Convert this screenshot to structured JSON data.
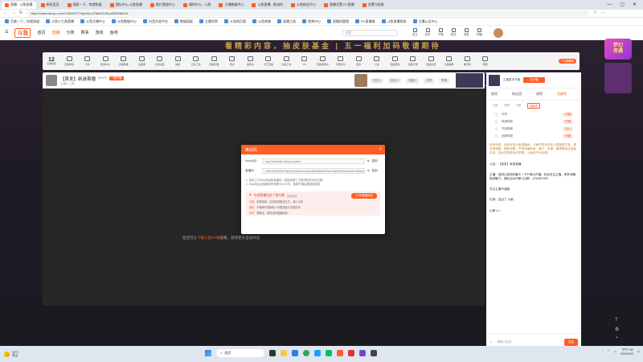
{
  "browser": {
    "tabs": [
      {
        "label": "直播 - 斗鱼直播",
        "active": true
      },
      {
        "label": "新标签页",
        "active": false
      },
      {
        "label": "搜索一下，你就知道",
        "active": false
      },
      {
        "label": "国际中心-斗鱼直播",
        "active": false
      },
      {
        "label": "图片管理中心",
        "active": false
      },
      {
        "label": "通知中心 - 斗鱼",
        "active": false
      },
      {
        "label": "主播数据中心",
        "active": false
      },
      {
        "label": "斗鱼直播 - 推流码",
        "active": false
      },
      {
        "label": "斗鱼粉丝中心",
        "active": false
      },
      {
        "label": "直播设置 PC直播",
        "active": false
      },
      {
        "label": "设置与权限",
        "active": false
      }
    ],
    "url": "https://www.douyu.com/12504573?dyshid=d7fbe63-5fbcd55808b3d1",
    "bookmarks": [
      "百度一下，你就知道",
      "斗鱼小工具直播",
      "斗鱼主播中心",
      "斗鱼数据中心",
      "抖音开放平台",
      "数据面板",
      "主播学院",
      "斗鱼网页版",
      "斗鱼商城",
      "直播工具",
      "视频中心",
      "直播间管理",
      "PC直播端",
      "斗鱼直播帮助",
      "主播认证中心"
    ]
  },
  "site": {
    "logo": "斗鱼",
    "nav": [
      "首页",
      "直播",
      "分类",
      "赛事",
      "游戏",
      "鱼吧"
    ],
    "search_placeholder": "搜索",
    "header_icons": [
      "关注",
      "历史",
      "下载",
      "任务",
      "消息",
      "开播"
    ]
  },
  "page": {
    "banner": "看精彩内容，抽皮肤基金  |  五一福利加码敬请期待",
    "promo_buttons": [
      "风暴boss",
      "永久直播",
      "dnsu7",
      "小霸梯",
      "扫码加一刀"
    ],
    "side_promo": "梦幻\n奇遇"
  },
  "toolbar": {
    "level": "12",
    "level_label": "主播等级",
    "items": [
      "直播伴侣",
      "分享",
      "粉丝中心",
      "直播数据",
      "主播课",
      "礼物设置",
      "抽奖",
      "互动工具",
      "直播管理",
      "连麦",
      "语音房",
      "才艺直播",
      "主播工具",
      "PK",
      "直播间装扮",
      "专属任务",
      "更多",
      "公会",
      "直播回放",
      "违规记录",
      "直播设置",
      "主播福利",
      "推流码",
      "帮助"
    ],
    "pc_badge": "PC直播端"
  },
  "room": {
    "title": "【首发】新游首播",
    "room_id": "房间号",
    "tag": "一键开播",
    "sub": "主播小工具",
    "stats": [
      "关注 0",
      "粉丝 0",
      "热度 0",
      "分享",
      "举报"
    ]
  },
  "video": {
    "button": "暂时休息",
    "text_prefix": "您还可以",
    "text_link": "下载斗鱼PC端",
    "text_suffix": "观看，获得更多直播体验"
  },
  "rpanel": {
    "top_label": "主播暂未开播",
    "top_btn": "去开播",
    "tabs": [
      "贵宾",
      "粉丝团",
      "周榜",
      "贡献榜"
    ],
    "subtabs": [
      "日榜",
      "周榜",
      "月榜",
      "超级榜"
    ],
    "items": [
      {
        "name": "守护",
        "pill": "开通"
      },
      {
        "name": "贵族特权",
        "pill": "开通"
      },
      {
        "name": "开启粉团",
        "pill": "加入"
      },
      {
        "name": "钻粉特权",
        "pill": "开通"
      }
    ],
    "chat_notice": "系统消息：欢迎来到斗鱼直播间，斗鱼严禁未成年人直播或打赏，请文明观看，理性消费，严禁传播低俗、暴力、色情、赌博等违法违规内容，如有发现请及时举报，斗鱼将严厉处理。",
    "chat_lines": [
      "公告：【首发】新游首播",
      "主播：[首发] 新游首播中（下午两点开播）欢迎关注主播，带你领略新游魅力，福利活动不断 QQ群：1234567890",
      "关注主播不迷路",
      "礼物：送出了 火箭",
      "火箭 x 1"
    ],
    "fold_text": "弹幕已关闭",
    "send_label": "发送"
  },
  "modal": {
    "title": "推流码",
    "server_label": "rtmp地址：",
    "server_value": "rtmp://sendtc3a.douyu.com/live",
    "key_label": "直播码：",
    "key_value": "12504573r6xSbTNg7d?wsSecret=a1b2c3d4e5f6&wsTime=662f3d15&wsSeek=off&wm=0&tw=0",
    "copy": "复制",
    "note1": "1. 复制上方rtmp地址和直播码，粘贴到第三方推流软件对应位置",
    "note2": "2. rtmp地址及直播码有效期为24小时，重新开播后需重新复制",
    "box_title": "在线直播用这个更方便",
    "box_subtitle": "推荐使用",
    "box_button": "打开直播伴侣",
    "box_lines": [
      {
        "k": "功能",
        "v": "简单易用，支持多种推流方式，减少卡顿"
      },
      {
        "k": "福利",
        "v": "开播即可领取新人专属奖励与流量扶持"
      },
      {
        "k": "安全",
        "v": "更稳定，更安全的直播体验"
      }
    ]
  },
  "taskbar": {
    "weather": "19°C",
    "weather_sub": "多云",
    "search": "搜索",
    "time": "下午7:36",
    "date": "2024/4/29"
  }
}
